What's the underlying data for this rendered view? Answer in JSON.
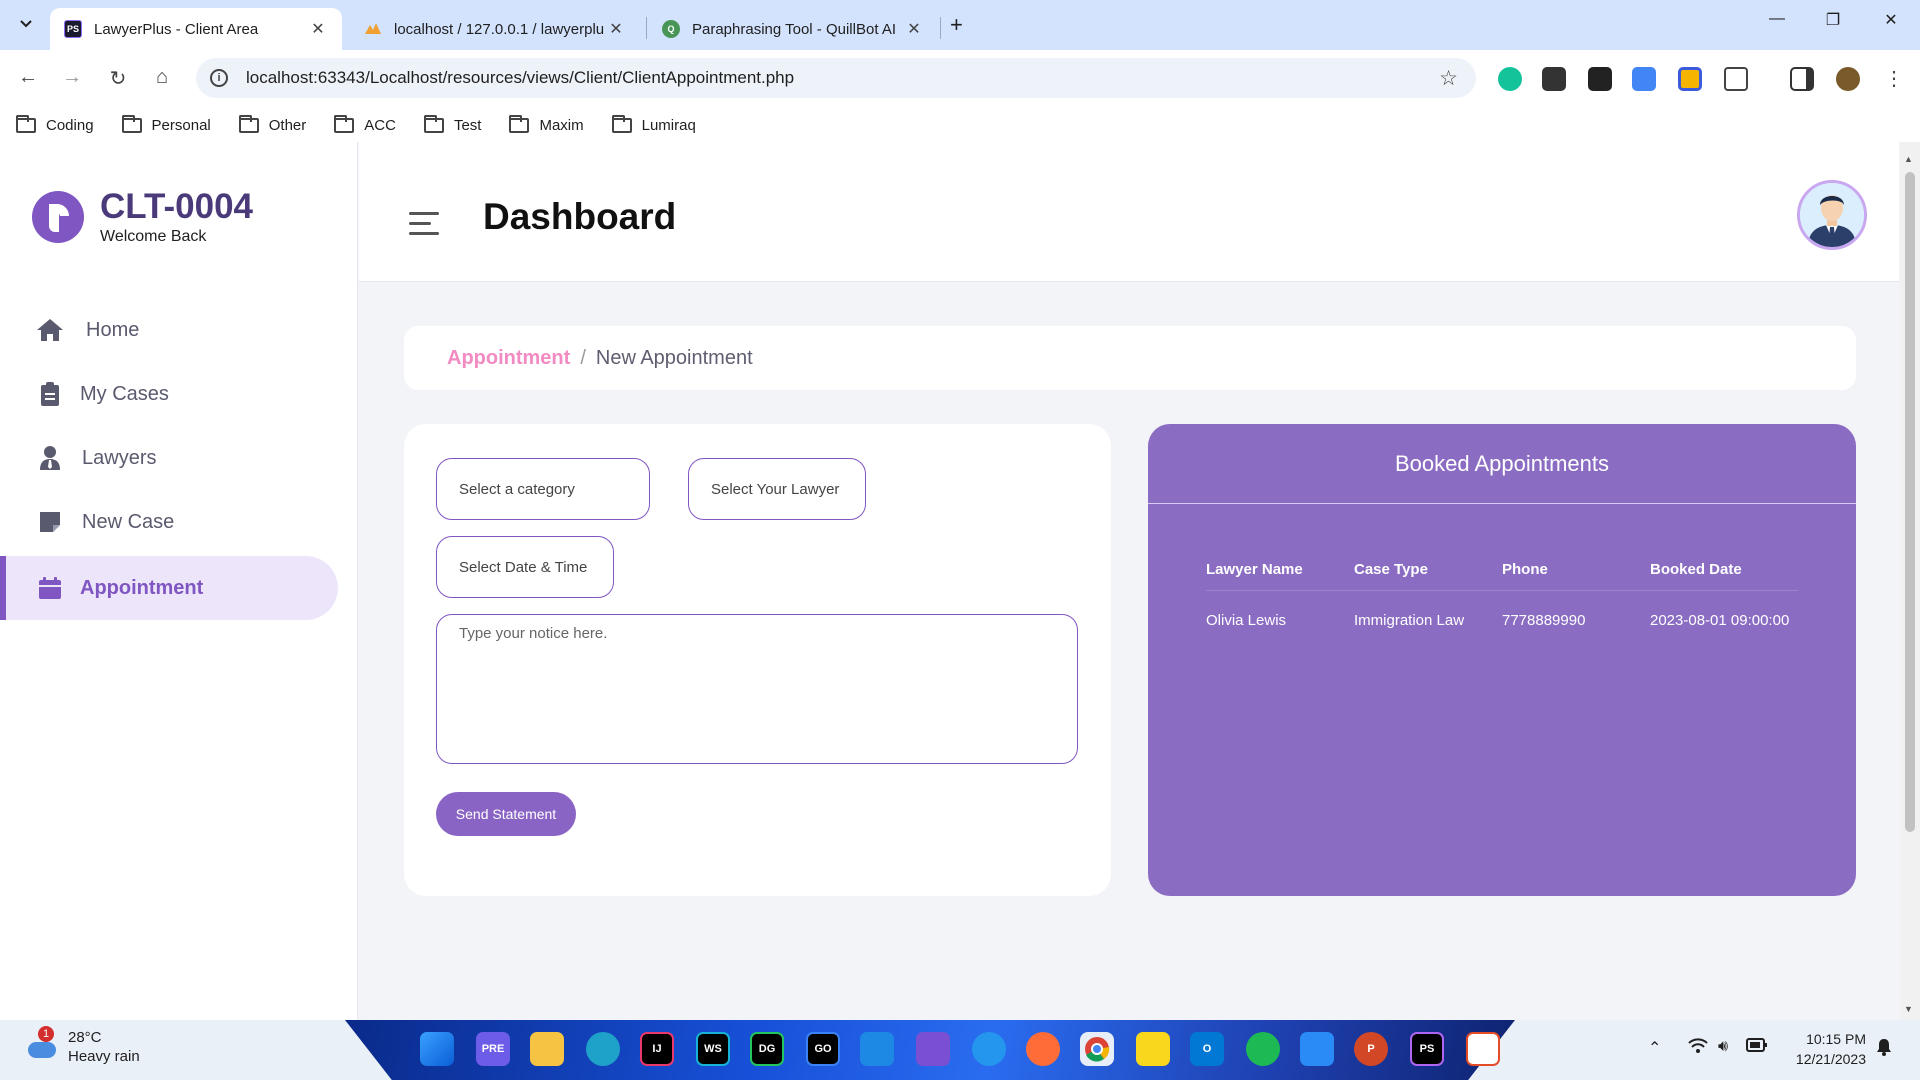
{
  "browser": {
    "tabs": [
      {
        "title": "LawyerPlus - Client Area",
        "favicon": "PS",
        "active": true
      },
      {
        "title": "localhost / 127.0.0.1 / lawyerplu",
        "favicon": "phpmyadmin-icon",
        "active": false
      },
      {
        "title": "Paraphrasing Tool - QuillBot AI",
        "favicon": "quillbot-icon",
        "active": false
      }
    ],
    "url": "localhost:63343/Localhost/resources/views/Client/ClientAppointment.php",
    "bookmarks": [
      "Coding",
      "Personal",
      "Other",
      "ACC",
      "Test",
      "Maxim",
      "Lumiraq"
    ]
  },
  "sidebar": {
    "client_id": "CLT-0004",
    "welcome": "Welcome Back",
    "items": [
      {
        "label": "Home",
        "icon": "home-icon"
      },
      {
        "label": "My Cases",
        "icon": "clipboard-icon"
      },
      {
        "label": "Lawyers",
        "icon": "user-tie-icon"
      },
      {
        "label": "New Case",
        "icon": "note-icon"
      },
      {
        "label": "Appointment",
        "icon": "calendar-icon",
        "active": true
      }
    ]
  },
  "header": {
    "title": "Dashboard"
  },
  "breadcrumb": {
    "link": "Appointment",
    "separator": "/",
    "current": "New Appointment"
  },
  "form": {
    "category_placeholder": "Select a category",
    "lawyer_placeholder": "Select Your Lawyer",
    "datetime_placeholder": "Select Date & Time",
    "notice_placeholder": "Type your notice here.",
    "submit_label": "Send Statement"
  },
  "booked": {
    "title": "Booked Appointments",
    "columns": [
      "Lawyer Name",
      "Case Type",
      "Phone",
      "Booked Date"
    ],
    "rows": [
      [
        "Olivia Lewis",
        "Immigration Law",
        "7778889990",
        "2023-08-01 09:00:00"
      ]
    ]
  },
  "taskbar": {
    "weather_badge": "1",
    "temperature": "28°C",
    "condition": "Heavy rain",
    "time": "10:15 PM",
    "date": "12/21/2023"
  },
  "colors": {
    "accent": "#7f56c2",
    "booked_card": "#8a6cc2",
    "breadcrumb_link": "#f28bc2"
  }
}
